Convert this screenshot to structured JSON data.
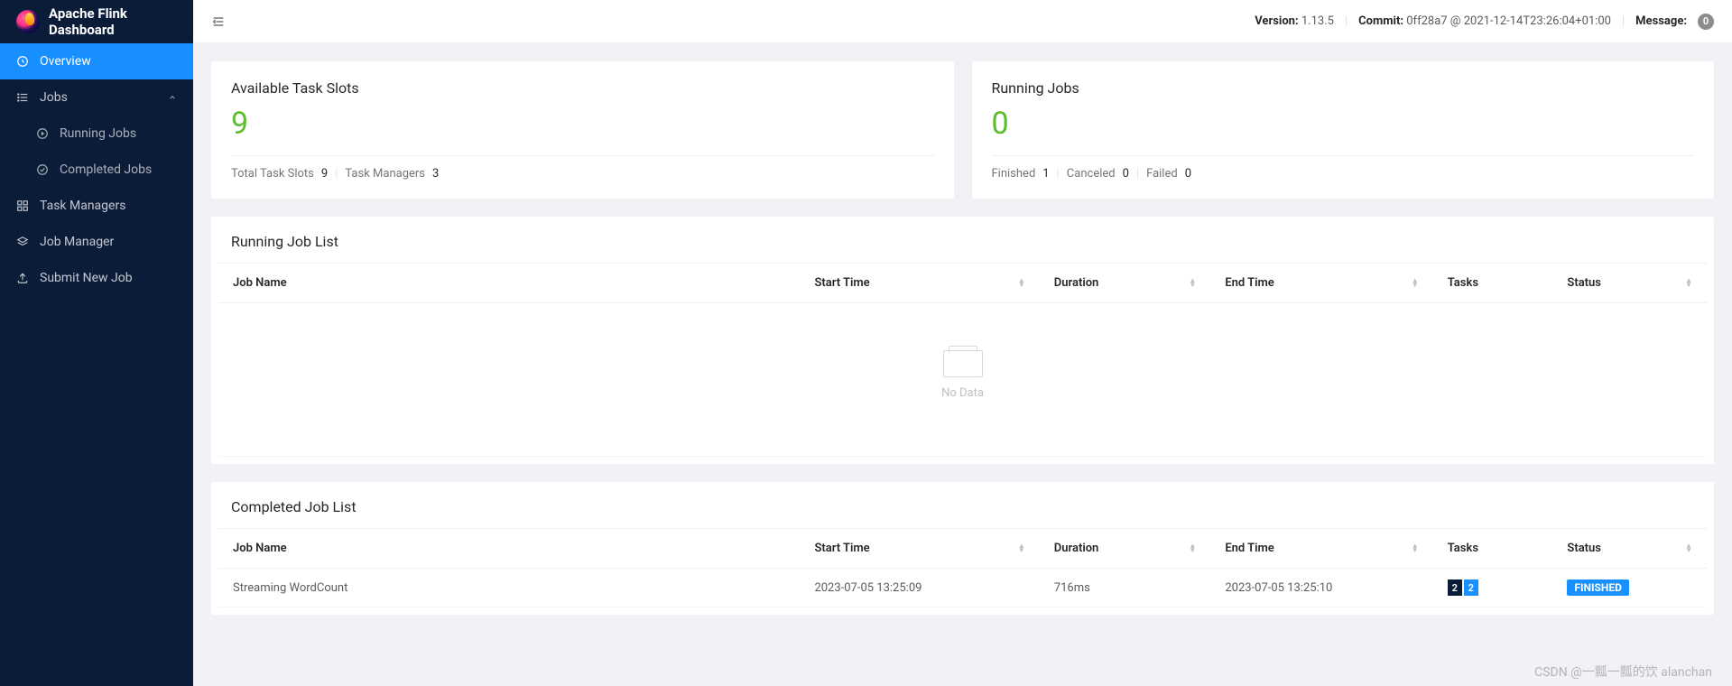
{
  "brand": {
    "title": "Apache Flink Dashboard"
  },
  "sidebar": {
    "overview": "Overview",
    "jobs": "Jobs",
    "running_jobs": "Running Jobs",
    "completed_jobs": "Completed Jobs",
    "task_managers": "Task Managers",
    "job_manager": "Job Manager",
    "submit_new_job": "Submit New Job"
  },
  "topbar": {
    "version_label": "Version:",
    "version_value": "1.13.5",
    "commit_label": "Commit:",
    "commit_value": "0ff28a7 @ 2021-12-14T23:26:04+01:00",
    "message_label": "Message:",
    "message_count": "0"
  },
  "stats": {
    "slots": {
      "title": "Available Task Slots",
      "value": "9",
      "total_label": "Total Task Slots",
      "total_value": "9",
      "tm_label": "Task Managers",
      "tm_value": "3"
    },
    "jobs": {
      "title": "Running Jobs",
      "value": "0",
      "finished_label": "Finished",
      "finished_value": "1",
      "canceled_label": "Canceled",
      "canceled_value": "0",
      "failed_label": "Failed",
      "failed_value": "0"
    }
  },
  "tables": {
    "running_title": "Running Job List",
    "completed_title": "Completed Job List",
    "columns": {
      "job_name": "Job Name",
      "start_time": "Start Time",
      "duration": "Duration",
      "end_time": "End Time",
      "tasks": "Tasks",
      "status": "Status"
    },
    "no_data": "No Data",
    "completed_rows": [
      {
        "job_name": "Streaming WordCount",
        "start_time": "2023-07-05 13:25:09",
        "duration": "716ms",
        "end_time": "2023-07-05 13:25:10",
        "tasks_a": "2",
        "tasks_b": "2",
        "status": "FINISHED"
      }
    ]
  },
  "watermark": "CSDN @一瓢一瓢的饮 alanchan"
}
